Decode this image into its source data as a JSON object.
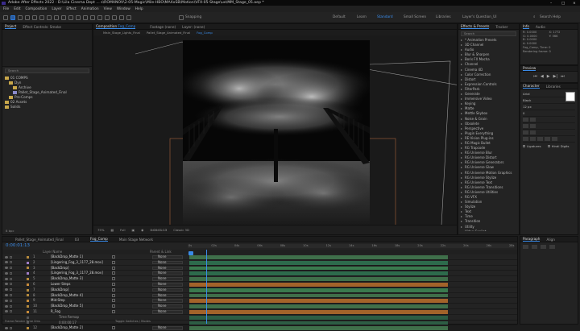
{
  "window": {
    "title": "Adobe After Effects 2022 - D:\\Lila Cinema Dept ... s\\ROMANOV\\2-05-Magic\\Mile-HBO\\MAXxSB\\Motion\\VFX-05-Stage\\ue\\MM_Stage_05.aep *",
    "controls": [
      "–",
      "□",
      "×"
    ]
  },
  "menu": [
    "File",
    "Edit",
    "Composition",
    "Layer",
    "Effect",
    "Animation",
    "View",
    "Window",
    "Help"
  ],
  "toolbar": {
    "snapping_label": "Snapping",
    "workspaces": [
      "Default",
      "Learn",
      "Standard",
      "Small Screen",
      "Libraries",
      "Layer's Question_UI"
    ],
    "active_workspace": "Standard",
    "search_label": "Search Help"
  },
  "project_panel": {
    "tabs": [
      "Project",
      "Effect Controls: Smoke"
    ],
    "search_placeholder": "Search",
    "items": [
      {
        "name": "01 COMPS",
        "depth": 0,
        "folder": true
      },
      {
        "name": "Dyn",
        "depth": 1,
        "folder": true
      },
      {
        "name": "Archive",
        "depth": 2,
        "folder": true
      },
      {
        "name": "Pallet_Stage_Animated_Final",
        "depth": 2,
        "folder": false
      },
      {
        "name": "Pre-Comps",
        "depth": 1,
        "folder": true
      },
      {
        "name": "02 Assets",
        "depth": 0,
        "folder": true
      },
      {
        "name": "Solids",
        "depth": 0,
        "folder": true
      }
    ],
    "footer": "8 bpc"
  },
  "composition_panel": {
    "tab_label": "Composition",
    "comp_name": "Fog_Comp",
    "extra_tabs": [
      "Footage (none)",
      "Layer: (none)"
    ],
    "breadcrumbs": [
      "Main_Stage_Lights_Final",
      "Pallet_Stage_Animated_Final",
      "Fog_Comp"
    ],
    "zoom": "75%",
    "quality": "Full",
    "timecode": "0:00:01:13",
    "renderer": "Classic 3D"
  },
  "effects_panel": {
    "tabs": [
      "Effects & Presets",
      "Tracker"
    ],
    "search_placeholder": "Search",
    "items": [
      "* Animation Presets",
      "3D Channel",
      "Audio",
      "Blur & Sharpen",
      "Boris FX Mocha",
      "Channel",
      "Cinema 4D",
      "Color Correction",
      "Distort",
      "Expression Controls",
      "FilterPark",
      "Generate",
      "Immersive Video",
      "Keying",
      "Matte",
      "Mettle Skybox",
      "Noise & Grain",
      "Obsolete",
      "Perspective",
      "Plugin Everything",
      "RE:Vision Plug-ins",
      "RG Magic Bullet",
      "RG Trapcode",
      "RG Universe Blur",
      "RG Universe Distort",
      "RG Universe Generators",
      "RG Universe Glow",
      "RG Universe Motion Graphics",
      "RG Universe Stylize",
      "RG Universe Text",
      "RG Universe Transitions",
      "RG Universe Utilities",
      "RG VFX",
      "Simulation",
      "Stylize",
      "Text",
      "Time",
      "Transition",
      "Utility",
      "Video Copilot"
    ]
  },
  "info_panel": {
    "tabs": [
      "Info",
      "Audio"
    ],
    "lines": [
      "X: 1772",
      "Y: 566",
      "R: 0.0000",
      "G: 0.0000",
      "B: 0.0000",
      "A: 0.0000",
      "Fog_Comp, Time: 0",
      "Rendering frame: 0"
    ]
  },
  "preview_panel": {
    "tab": "Preview"
  },
  "character_panel": {
    "tabs": [
      "Character",
      "Libraries"
    ],
    "font": "Arial",
    "style": "Black",
    "size": "12 px",
    "tracking": "0",
    "ligatures_label": "Ligatures",
    "hindi_label": "Hindi Digits"
  },
  "paragraph_panel": {
    "tabs": [
      "Paragraph",
      "Align"
    ]
  },
  "timeline": {
    "tabs": [
      "Pallet_Stage_Animated_Final",
      "03",
      "Fog_Comp",
      "Main Stage Network"
    ],
    "active_tab": "Fog_Comp",
    "timecode": "0:00:01:13",
    "header": {
      "layer_name": "Layer Name",
      "parent": "Parent & Link"
    },
    "ruler_ticks": [
      "0s",
      "02s",
      "04s",
      "06s",
      "08s",
      "10s",
      "12s",
      "14s",
      "16s",
      "18s",
      "20s",
      "22s",
      "24s",
      "26s",
      "28s"
    ],
    "layers": [
      {
        "num": "1",
        "name": "[BackDrop_Matte 1]",
        "color": "#b58a3c",
        "bar": "#3f6f4a",
        "parent": "None"
      },
      {
        "num": "2",
        "name": "[Lingering_Fog_3_1177_28.mov]",
        "color": "#a07ec8",
        "bar": "#2d6b4c",
        "parent": "None"
      },
      {
        "num": "3",
        "name": "[BackDrop]",
        "color": "#b58a3c",
        "bar": "#3a7a4e",
        "parent": "None"
      },
      {
        "num": "4",
        "name": "[Lingering_Fog_3_1177_28.mov]",
        "color": "#a07ec8",
        "bar": "#2d6b4c",
        "parent": "None"
      },
      {
        "num": "5",
        "name": "[BackDrop_Matte 3]",
        "color": "#b58a3c",
        "bar": "#3f6f4a",
        "parent": "None"
      },
      {
        "num": "6",
        "name": "Lower Steps",
        "color": "#c98b3a",
        "bar": "#a3632a",
        "parent": "None"
      },
      {
        "num": "7",
        "name": "[BackDrop]",
        "color": "#b58a3c",
        "bar": "#3a7a4e",
        "parent": "None"
      },
      {
        "num": "8",
        "name": "[BackDrop_Matte 4]",
        "color": "#b58a3c",
        "bar": "#3f6f4a",
        "parent": "None"
      },
      {
        "num": "9",
        "name": "Mid-Step",
        "color": "#c98b3a",
        "bar": "#a3632a",
        "parent": "None"
      },
      {
        "num": "10",
        "name": "[BackDrop_Matte 5]",
        "color": "#b58a3c",
        "bar": "#3f6f4a",
        "parent": "None"
      },
      {
        "num": "11",
        "name": "R_Fog",
        "color": "#c98b3a",
        "bar": "#a3632a",
        "parent": "None"
      },
      {
        "num": "",
        "name": "Time Remap",
        "color": "#555555",
        "bar": "#2d5d44",
        "parent": ""
      },
      {
        "num": "",
        "name": "0:00:00:17",
        "color": "#555555",
        "bar": "#2d5d44",
        "parent": ""
      },
      {
        "num": "12",
        "name": "[BackDrop_Matte 2]",
        "color": "#b58a3c",
        "bar": "#3f6f4a",
        "parent": "None"
      }
    ],
    "footer": "Frame Render Time  0ms",
    "footer_right": "Toggle Switches / Modes"
  }
}
